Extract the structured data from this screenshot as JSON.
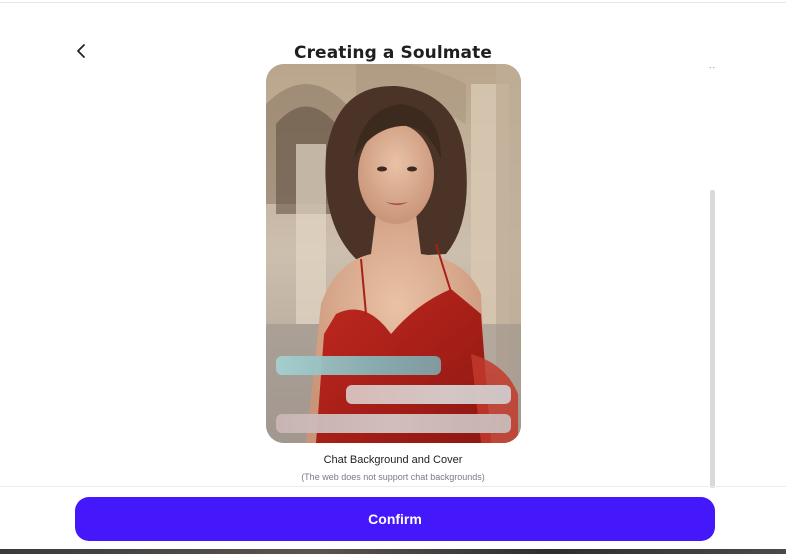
{
  "header": {
    "title": "Creating a Soulmate",
    "back_icon": "chevron-left-icon",
    "overflow_text": ".."
  },
  "card": {
    "image_description_icon": "portrait-image",
    "caption": "Chat Background and Cover",
    "subcaption": "(The web does not support chat backgrounds)"
  },
  "footer": {
    "confirm_label": "Confirm"
  },
  "colors": {
    "accent": "#4418fb",
    "title": "#1f1f1f"
  }
}
